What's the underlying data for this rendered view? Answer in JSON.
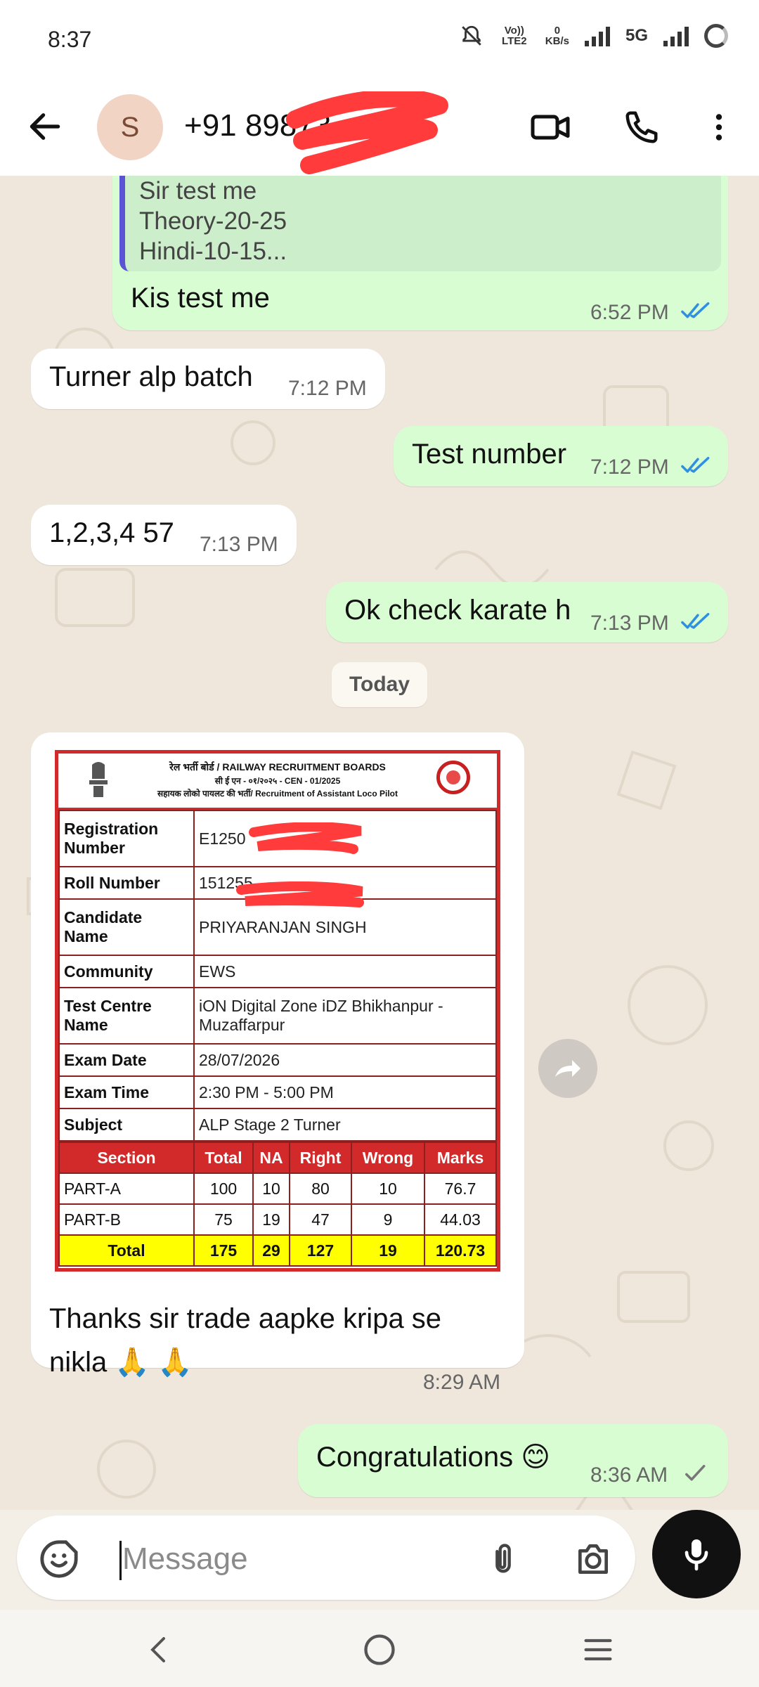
{
  "status_bar": {
    "time": "8:37",
    "network_volte": "Vo)) LTE2",
    "speed_value": "0",
    "speed_unit": "KB/s",
    "network_type": "5G"
  },
  "header": {
    "avatar_letter": "S",
    "contact_number": "+91 89873",
    "icons": [
      "back-arrow-icon",
      "video-call-icon",
      "phone-icon",
      "more-vert-icon"
    ]
  },
  "messages": {
    "m1": {
      "quote_lines": [
        "Sir test me",
        "Theory-20-25",
        "Hindi-10-15..."
      ],
      "text": "Kis test me",
      "time": "6:52 PM",
      "status": "read"
    },
    "m2": {
      "text": "Turner alp batch",
      "time": "7:12 PM"
    },
    "m3": {
      "text": "Test number",
      "time": "7:12 PM",
      "status": "read"
    },
    "m4": {
      "text": "1,2,3,4 57",
      "time": "7:13 PM"
    },
    "m5": {
      "text": "Ok check karate h",
      "time": "7:13 PM",
      "status": "read"
    },
    "date_divider": "Today",
    "m6": {
      "text_line1": "Thanks sir trade aapke kripa se",
      "text_line2": "nikla 🙏 🙏",
      "time": "8:29 AM"
    },
    "m7": {
      "text": "Congratulations 😊",
      "time": "8:36 AM",
      "status": "sent"
    }
  },
  "scorecard": {
    "title_line1": "रेल भर्ती बोर्ड / RAILWAY RECRUITMENT BOARDS",
    "title_line2": "सी ई एन - ०१/२०२५ - CEN - 01/2025",
    "title_line3": "सहायक लोको पायलट की भर्ती/ Recruitment of Assistant Loco Pilot",
    "fields": {
      "registration_label": "Registration Number",
      "registration_value": "E1250",
      "roll_label": "Roll Number",
      "roll_value": "151255",
      "candidate_label": "Candidate Name",
      "candidate_value": "PRIYARANJAN SINGH",
      "community_label": "Community",
      "community_value": "EWS",
      "centre_label": "Test Centre Name",
      "centre_value": "iON Digital Zone iDZ Bhikhanpur - Muzaffarpur",
      "exam_date_label": "Exam Date",
      "exam_date_value": "28/07/2026",
      "exam_time_label": "Exam Time",
      "exam_time_value": "2:30 PM - 5:00 PM",
      "subject_label": "Subject",
      "subject_value": "ALP Stage 2 Turner"
    },
    "score_headers": [
      "Section",
      "Total",
      "NA",
      "Right",
      "Wrong",
      "Marks"
    ],
    "score_rows": [
      [
        "PART-A",
        "100",
        "10",
        "80",
        "10",
        "76.7"
      ],
      [
        "PART-B",
        "75",
        "19",
        "47",
        "9",
        "44.03"
      ],
      [
        "Total",
        "175",
        "29",
        "127",
        "19",
        "120.73"
      ]
    ]
  },
  "input_bar": {
    "placeholder": "Message",
    "icons": [
      "sticker-icon",
      "attach-icon",
      "camera-icon",
      "mic-icon"
    ]
  },
  "nav_bar": {
    "icons": [
      "nav-back-icon",
      "nav-home-icon",
      "nav-recents-icon"
    ]
  },
  "colors": {
    "outgoing_bubble": "#d9fdd3",
    "incoming_bubble": "#ffffff",
    "read_ticks": "#2f8fe0",
    "scorecard_red": "#d22a2a",
    "total_row_yellow": "#ffff00"
  }
}
